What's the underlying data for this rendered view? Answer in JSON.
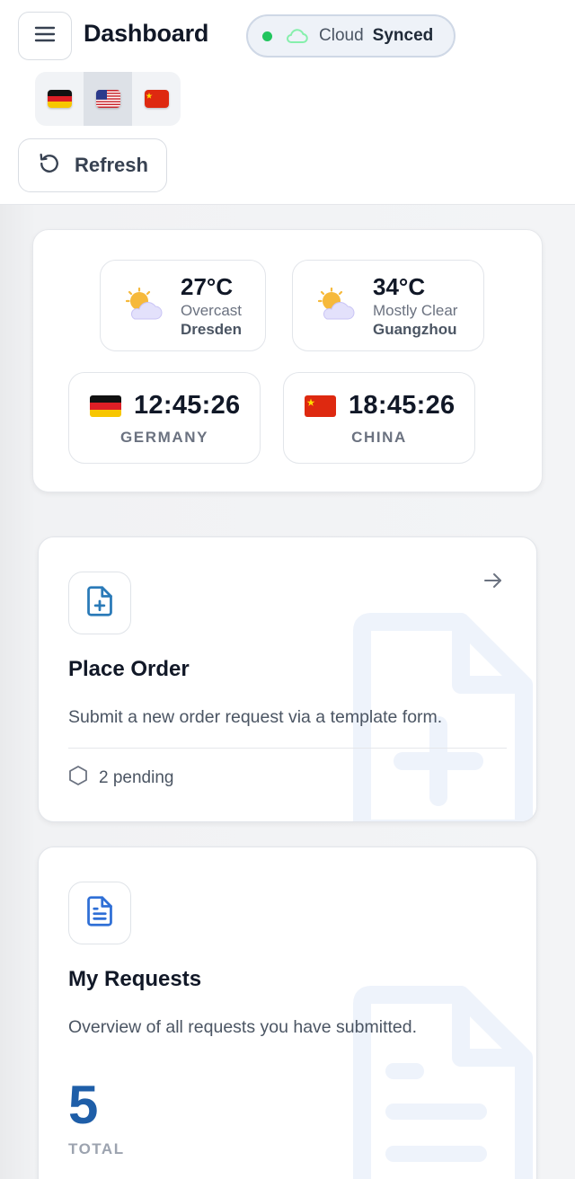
{
  "header": {
    "title": "Dashboard",
    "menu_icon": "hamburger-menu-icon",
    "cloud": {
      "label": "Cloud",
      "status": "Synced",
      "status_color": "#22c55e"
    },
    "languages": [
      {
        "code": "de",
        "flag": "germany-flag-icon",
        "active": false
      },
      {
        "code": "en",
        "flag": "usa-flag-icon",
        "active": true
      },
      {
        "code": "zh",
        "flag": "china-flag-icon",
        "active": false
      }
    ],
    "refresh_label": "Refresh"
  },
  "weather": [
    {
      "temp": "27°C",
      "condition": "Overcast",
      "city": "Dresden",
      "icon": "partly-cloudy-icon"
    },
    {
      "temp": "34°C",
      "condition": "Mostly Clear",
      "city": "Guangzhou",
      "icon": "partly-cloudy-icon"
    }
  ],
  "clocks": [
    {
      "time": "12:45:26",
      "country": "GERMANY",
      "flag": "germany-flag-icon"
    },
    {
      "time": "18:45:26",
      "country": "CHINA",
      "flag": "china-flag-icon"
    }
  ],
  "cards": {
    "place_order": {
      "title": "Place Order",
      "description": "Submit a new order request via a template form.",
      "pending": "2 pending",
      "icon": "file-plus-icon"
    },
    "my_requests": {
      "title": "My Requests",
      "description": "Overview of all requests you have submitted.",
      "count": "5",
      "count_label": "TOTAL",
      "icon": "file-text-icon"
    }
  },
  "colors": {
    "accent": "#1e5ea8",
    "icon_blue": "#2a7ab8",
    "watermark": "#eef3fb"
  }
}
